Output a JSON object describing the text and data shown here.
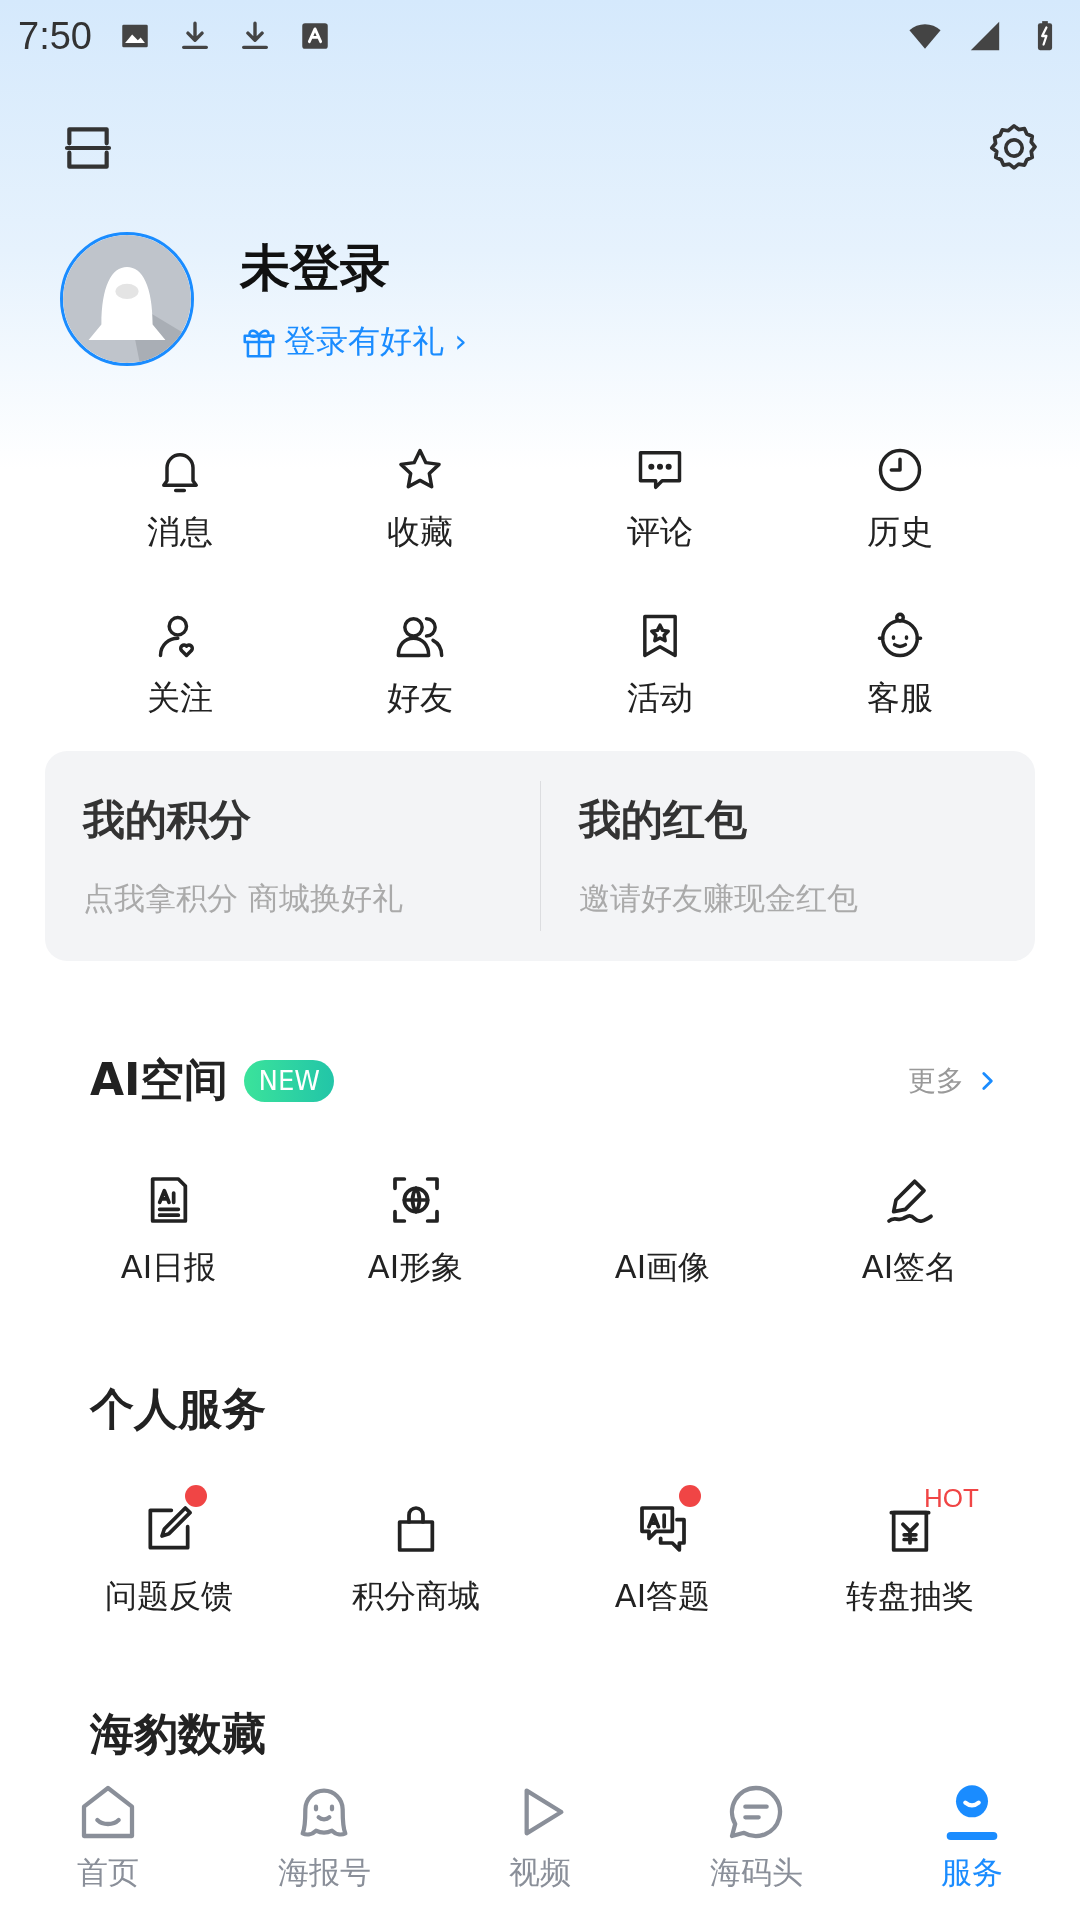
{
  "status_bar": {
    "time": "7:50"
  },
  "profile": {
    "name": "未登录",
    "login_hint": "登录有好礼",
    "chevron": "›"
  },
  "shortcuts": [
    {
      "label": "消息"
    },
    {
      "label": "收藏"
    },
    {
      "label": "评论"
    },
    {
      "label": "历史"
    },
    {
      "label": "关注"
    },
    {
      "label": "好友"
    },
    {
      "label": "活动"
    },
    {
      "label": "客服"
    }
  ],
  "cards": [
    {
      "title": "我的积分",
      "subtitle": "点我拿积分 商城换好礼"
    },
    {
      "title": "我的红包",
      "subtitle": "邀请好友赚现金红包"
    }
  ],
  "ai_section": {
    "title": "AI空间",
    "badge": "NEW",
    "more": "更多",
    "items": [
      {
        "label": "AI日报",
        "has_icon": true
      },
      {
        "label": "AI形象",
        "has_icon": true
      },
      {
        "label": "AI画像",
        "has_icon": false
      },
      {
        "label": "AI签名",
        "has_icon": true
      }
    ]
  },
  "personal_section": {
    "title": "个人服务",
    "items": [
      {
        "label": "问题反馈",
        "dot": true
      },
      {
        "label": "积分商城",
        "dot": false
      },
      {
        "label": "AI答题",
        "dot": true
      },
      {
        "label": "转盘抽奖",
        "dot": false,
        "tag": "HOT"
      }
    ]
  },
  "collectibles_section": {
    "title": "海豹数藏"
  },
  "bottom_nav": [
    {
      "label": "首页",
      "selected": false
    },
    {
      "label": "海报号",
      "selected": false
    },
    {
      "label": "视频",
      "selected": false
    },
    {
      "label": "海码头",
      "selected": false
    },
    {
      "label": "服务",
      "selected": true
    }
  ]
}
